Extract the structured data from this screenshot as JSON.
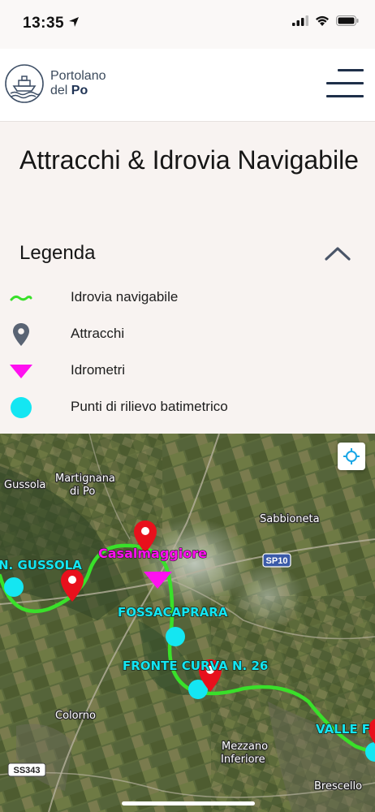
{
  "status": {
    "time": "13:35"
  },
  "header": {
    "logo_line1": "Portolano",
    "logo_line2_a": "del ",
    "logo_line2_b": "Po"
  },
  "page": {
    "title": "Attracchi & Idrovia Navigabile"
  },
  "legend": {
    "title": "Legenda",
    "items": [
      {
        "label": "Idrovia navigabile",
        "icon": "green-wave-icon",
        "color": "#39e02a"
      },
      {
        "label": "Attracchi",
        "icon": "map-pin-icon",
        "color": "#5a6474"
      },
      {
        "label": "Idrometri",
        "icon": "magenta-triangle-icon",
        "color": "#ff10f0"
      },
      {
        "label": "Punti di rilievo batimetrico",
        "icon": "cyan-dot-icon",
        "color": "#14e6f2"
      }
    ]
  },
  "map": {
    "towns": [
      {
        "name": "Gussola"
      },
      {
        "name": "Martignana"
      },
      {
        "name": "di Po"
      },
      {
        "name": "Sabbioneta"
      },
      {
        "name": "Colorno"
      },
      {
        "name": "Mezzano"
      },
      {
        "name": "Inferiore"
      },
      {
        "name": "Brescello"
      }
    ],
    "roads": [
      {
        "name": "SP10"
      },
      {
        "name": "SS343"
      }
    ],
    "station_labels": [
      {
        "name": "N. GUSSOLA"
      },
      {
        "name": "FOSSACAPRARA"
      },
      {
        "name": "FRONTE CURVA N. 26"
      },
      {
        "name": "VALLE F"
      }
    ],
    "gauge_label": "Casalmaggiore",
    "colors": {
      "route": "#39e02a",
      "pin": "#e8101c",
      "gauge": "#ff10f0",
      "survey": "#14e6f2"
    }
  }
}
